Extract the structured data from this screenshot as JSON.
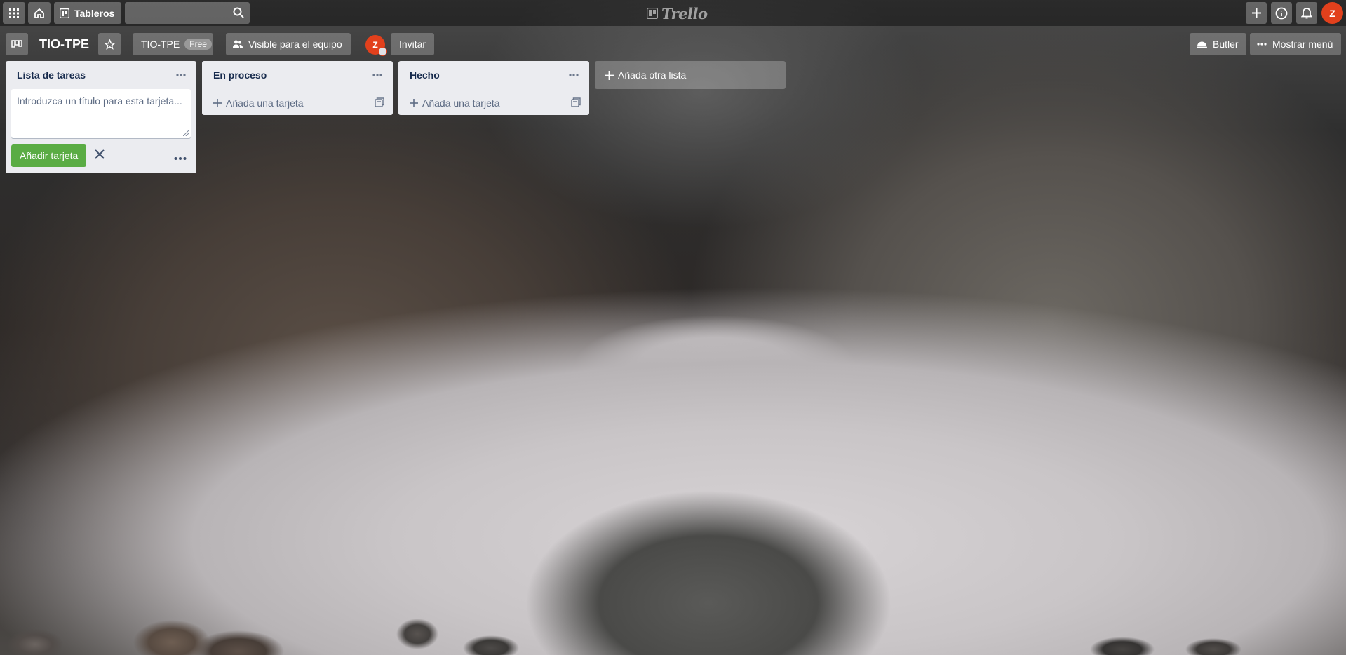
{
  "header": {
    "apps_icon": "grid-icon",
    "home_icon": "home-icon",
    "boards_label": "Tableros",
    "search": {
      "value": "",
      "placeholder": ""
    },
    "logo_text": "Trello",
    "user_initial": "Z"
  },
  "board": {
    "title": "TIO-TPE",
    "team_name": "TIO-TPE",
    "plan_badge": "Free",
    "visibility_label": "Visible para el equipo",
    "member_initial": "Z",
    "invite_label": "Invitar",
    "butler_label": "Butler",
    "menu_label": "Mostrar menú"
  },
  "lists": [
    {
      "title": "Lista de tareas",
      "composer": {
        "placeholder": "Introduzca un título para esta tarjeta...",
        "add_button_label": "Añadir tarjeta"
      }
    },
    {
      "title": "En proceso",
      "add_card_label": "Añada una tarjeta"
    },
    {
      "title": "Hecho",
      "add_card_label": "Añada una tarjeta"
    }
  ],
  "add_list_label": "Añada otra lista",
  "colors": {
    "accent_green": "#5aac44",
    "avatar_red": "#e2401c",
    "list_bg": "#ebecf0"
  }
}
